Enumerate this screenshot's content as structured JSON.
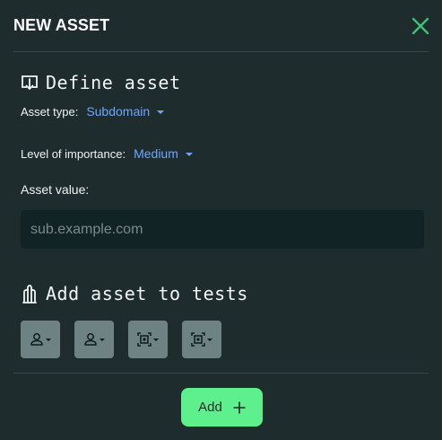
{
  "header": {
    "title": "NEW ASSET"
  },
  "define": {
    "title": "Define asset",
    "asset_type_label": "Asset type:",
    "asset_type_value": "Subdomain",
    "importance_label": "Level of importance:",
    "importance_value": "Medium",
    "asset_value_label": "Asset value:",
    "asset_value_placeholder": "sub.example.com",
    "asset_value": ""
  },
  "tests": {
    "title": "Add asset to tests",
    "buttons": [
      {
        "icon": "user-icon"
      },
      {
        "icon": "user-icon"
      },
      {
        "icon": "scan-target-icon"
      },
      {
        "icon": "scan-target-icon"
      }
    ]
  },
  "footer": {
    "add_label": "Add"
  },
  "colors": {
    "background": "#1e2c2d",
    "accent_green": "#5ef08c",
    "close_icon": "#3ec27a",
    "link_blue": "#6ea6ff",
    "input_bg": "#112324",
    "test_button_bg": "#6e8283"
  }
}
